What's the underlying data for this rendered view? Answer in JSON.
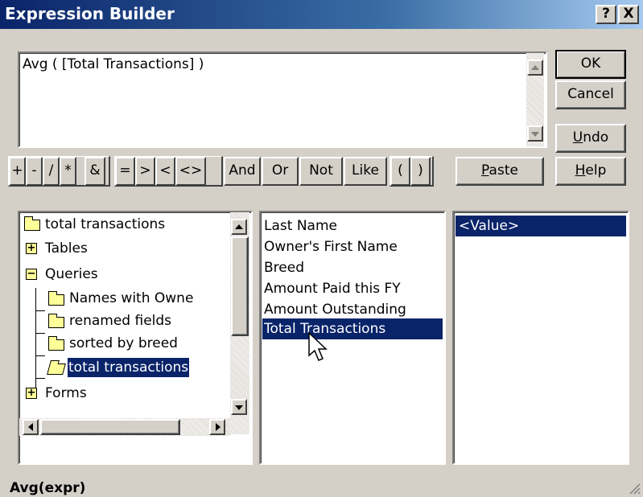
{
  "window": {
    "title": "Expression Builder",
    "help_btn": "?",
    "close_btn": "X"
  },
  "expression": {
    "value": "Avg ( [Total Transactions] )"
  },
  "buttons": {
    "ok": "OK",
    "cancel": "Cancel",
    "undo_u": "U",
    "undo_rest": "ndo",
    "paste_u": "P",
    "paste_rest": "aste",
    "help_u": "H",
    "help_rest": "elp"
  },
  "operators": [
    "+",
    "-",
    "/",
    "*",
    "&",
    "=",
    ">",
    "<",
    "<>",
    "And",
    "Or",
    "Not",
    "Like",
    "(",
    ")"
  ],
  "tree": {
    "items": [
      {
        "label": "total transactions",
        "icon": "folder-icon"
      },
      {
        "label": "Tables",
        "icon": "plus-icon"
      },
      {
        "label": "Queries",
        "icon": "minus-icon"
      },
      {
        "label": "Names with Owne",
        "icon": "folder-icon"
      },
      {
        "label": "renamed fields",
        "icon": "folder-icon"
      },
      {
        "label": "sorted by breed",
        "icon": "folder-icon"
      },
      {
        "label": "total transactions",
        "icon": "open-folder-icon",
        "selected": true
      },
      {
        "label": "Forms",
        "icon": "plus-icon"
      }
    ]
  },
  "fields": {
    "items": [
      "Last Name",
      "Owner's First Name",
      "Breed",
      "Amount Paid this FY",
      "Amount Outstanding",
      "Total Transactions"
    ],
    "selected": "Total Transactions"
  },
  "values": {
    "items": [
      "<Value>"
    ],
    "selected": "<Value>"
  },
  "status": {
    "text": "Avg(expr)"
  },
  "colors": {
    "selection": "#0a246a",
    "dialog": "#d4d0c8"
  }
}
